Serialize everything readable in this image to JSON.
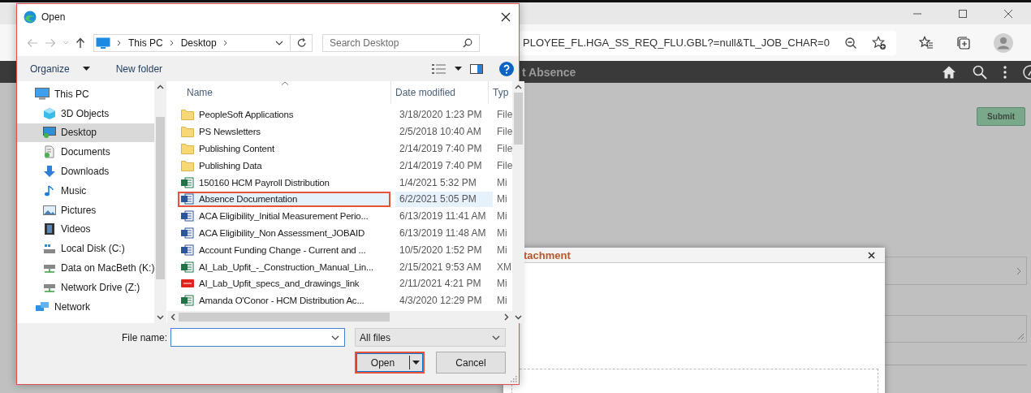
{
  "dialog": {
    "title": "Open",
    "breadcrumb": [
      "This PC",
      "Desktop"
    ],
    "search": {
      "placeholder": "Search Desktop"
    },
    "toolbar": [
      "Organize",
      "New folder"
    ],
    "nav": [
      {
        "label": "This PC",
        "selected": false,
        "children": [
          {
            "label": "3D Objects",
            "selected": false
          },
          {
            "label": "Desktop",
            "selected": true
          },
          {
            "label": "Documents",
            "selected": false
          },
          {
            "label": "Downloads",
            "selected": false
          },
          {
            "label": "Music",
            "selected": false
          },
          {
            "label": "Pictures",
            "selected": false
          },
          {
            "label": "Videos",
            "selected": false
          },
          {
            "label": "Local Disk (C:)",
            "selected": false
          },
          {
            "label": "Data on MacBeth (K:)",
            "selected": false
          },
          {
            "label": "Network Drive (Z:)",
            "selected": false
          }
        ]
      },
      {
        "label": "Network",
        "selected": false
      }
    ],
    "columns": [
      "Name",
      "Date modified",
      "Typ"
    ],
    "files": [
      {
        "name": "PeopleSoft Applications",
        "date": "3/18/2020 1:23 PM",
        "type": "File",
        "kind": "folder",
        "selected": false,
        "annotated": false
      },
      {
        "name": "PS Newsletters",
        "date": "2/5/2018 10:40 AM",
        "type": "File",
        "kind": "folder",
        "selected": false,
        "annotated": false
      },
      {
        "name": "Publishing Content",
        "date": "2/14/2019 7:40 PM",
        "type": "File",
        "kind": "folder",
        "selected": false,
        "annotated": false
      },
      {
        "name": "Publishing Data",
        "date": "2/14/2019 7:40 PM",
        "type": "File",
        "kind": "folder",
        "selected": false,
        "annotated": false
      },
      {
        "name": "150160 HCM Payroll Distribution",
        "date": "1/4/2021 5:32 PM",
        "type": "Mi",
        "kind": "excel",
        "selected": false,
        "annotated": false
      },
      {
        "name": "Absence Documentation",
        "date": "6/2/2021 5:05 PM",
        "type": "Mi",
        "kind": "word",
        "selected": true,
        "annotated": true
      },
      {
        "name": "ACA Eligibility_Initial Measurement Perio...",
        "date": "6/13/2019 11:41 AM",
        "type": "Mi",
        "kind": "word",
        "selected": false,
        "annotated": false
      },
      {
        "name": "ACA Eligibility_Non Assessment_JOBAID",
        "date": "6/13/2019 11:48 AM",
        "type": "Mi",
        "kind": "word",
        "selected": false,
        "annotated": false
      },
      {
        "name": "Account Funding Change - Current and ...",
        "date": "10/5/2020 1:52 PM",
        "type": "Mi",
        "kind": "word",
        "selected": false,
        "annotated": false
      },
      {
        "name": "AI_Lab_Upfit_-_Construction_Manual_Lin...",
        "date": "2/15/2021 9:53 AM",
        "type": "XM",
        "kind": "excel",
        "selected": false,
        "annotated": false
      },
      {
        "name": "AI_Lab_Upfit_specs_and_drawings_link",
        "date": "2/11/2021 4:21 PM",
        "type": "Mi",
        "kind": "pdf",
        "selected": false,
        "annotated": false
      },
      {
        "name": "Amanda O'Conor - HCM Distribution Ac...",
        "date": "4/3/2020 12:29 PM",
        "type": "Mi",
        "kind": "excel",
        "selected": false,
        "annotated": false
      }
    ],
    "file_name": {
      "label": "File name:"
    },
    "filter": "All files",
    "buttons": [
      {
        "label": "Open",
        "kind": "split",
        "annotated": true
      },
      {
        "label": "Cancel",
        "kind": "plain",
        "annotated": false
      }
    ]
  },
  "browser": {
    "url": "PLOYEE_FL.HGA_SS_REQ_FLU.GBL?=null&TL_JOB_CHAR=0",
    "page_title": "t Absence",
    "submit": "Submit",
    "modal": {
      "title": "tachment"
    }
  }
}
